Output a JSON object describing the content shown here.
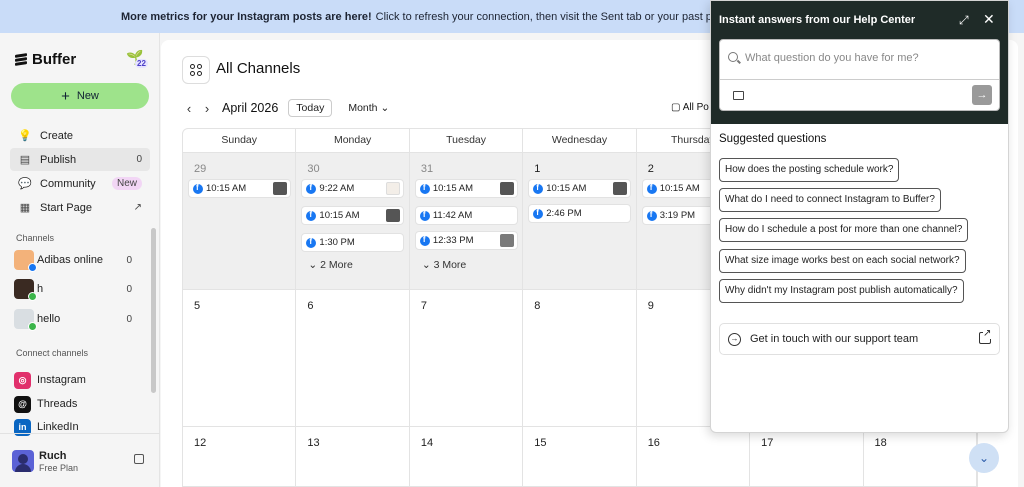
{
  "banner": {
    "bold_text": "More metrics for your Instagram posts are here!",
    "text": "Click to refresh your connection, then visit the Sent tab or your past posts to see ho"
  },
  "sidebar": {
    "logo": "Buffer",
    "sprout_count": "22",
    "new_label": "New",
    "nav": [
      {
        "label": "Create",
        "count": ""
      },
      {
        "label": "Publish",
        "count": "0"
      },
      {
        "label": "Community",
        "badge": "New"
      },
      {
        "label": "Start Page",
        "count": ""
      }
    ],
    "channels_label": "Channels",
    "channels": [
      {
        "name": "Adibas online",
        "count": "0"
      },
      {
        "name": "h",
        "count": "0"
      },
      {
        "name": "hello",
        "count": "0"
      }
    ],
    "connect_label": "Connect channels",
    "connect": [
      {
        "name": "Instagram"
      },
      {
        "name": "Threads"
      },
      {
        "name": "LinkedIn"
      }
    ],
    "user": {
      "name": "Ruch",
      "plan": "Free Plan"
    }
  },
  "main": {
    "title": "All Channels",
    "month": "April 2026",
    "today": "Today",
    "view": "Month",
    "all_posts": "All Po",
    "days": [
      "Sunday",
      "Monday",
      "Tuesday",
      "Wednesday",
      "Thursday"
    ],
    "week1": [
      {
        "num": "29",
        "posts": [
          "10:15 AM"
        ]
      },
      {
        "num": "30",
        "posts": [
          "9:22 AM",
          "10:15 AM",
          "1:30 PM"
        ],
        "more": "2 More"
      },
      {
        "num": "31",
        "posts": [
          "10:15 AM",
          "11:42 AM",
          "12:33 PM"
        ],
        "more": "3 More"
      },
      {
        "num": "1",
        "posts": [
          "10:15 AM",
          "2:46 PM"
        ]
      },
      {
        "num": "2",
        "posts": [
          "10:15 AM",
          "3:19 PM"
        ]
      }
    ],
    "week2": [
      "5",
      "6",
      "7",
      "8",
      "9"
    ],
    "week3": [
      "12",
      "13",
      "14",
      "15",
      "16",
      "17",
      "18"
    ]
  },
  "help": {
    "title": "Instant answers from our Help Center",
    "search_placeholder": "What question do you have for me?",
    "suggested_title": "Suggested questions",
    "questions": [
      "How does the posting schedule work?",
      "What do I need to connect Instagram to Buffer?",
      "How do I schedule a post for more than one channel?",
      "What size image works best on each social network?",
      "Why didn't my Instagram post publish automatically?"
    ],
    "support": "Get in touch with our support team"
  }
}
